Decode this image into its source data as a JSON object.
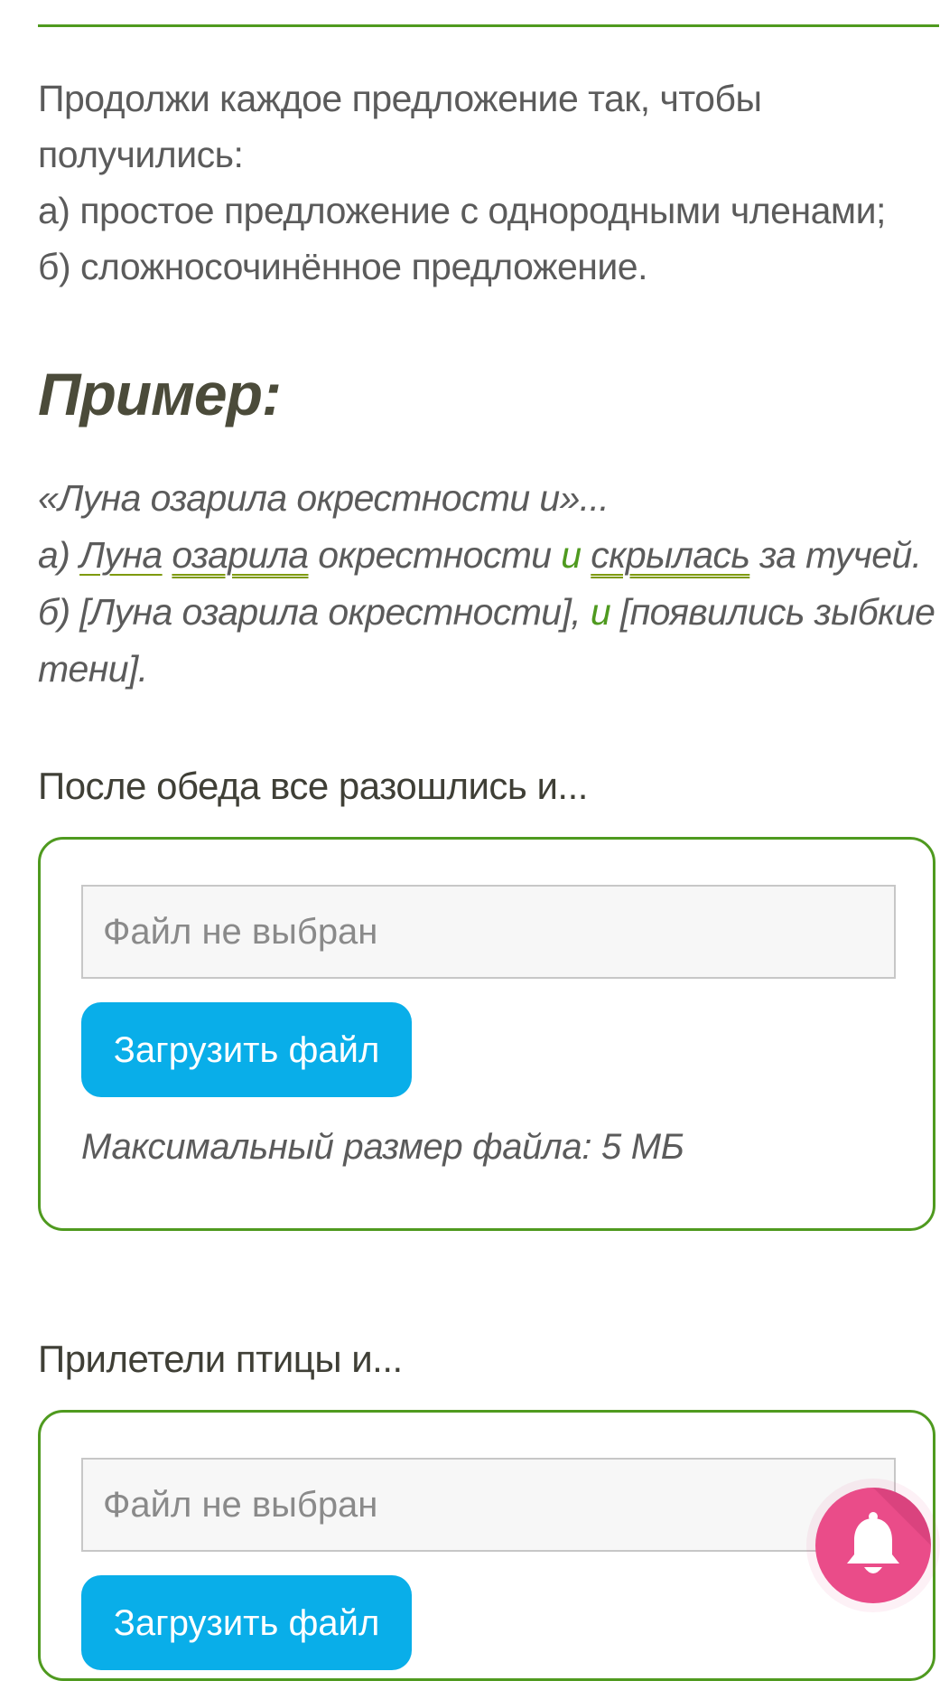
{
  "instructions": {
    "line1": "Продолжи каждое предложение так, чтобы",
    "line2": "получились:",
    "line3": "а) простое предложение с однородными членами;",
    "line4": "б) сложносочинённое предложение."
  },
  "example": {
    "heading": "Пример:",
    "quote": "«Луна озарила окрестности и»...",
    "a_prefix": "а) ",
    "a_subject": "Луна",
    "a_space1": " ",
    "a_predicate1": "озарила",
    "a_middle": " окрестности ",
    "a_conj": "и",
    "a_space2": " ",
    "a_predicate2": "скрылась",
    "a_end": " за тучей.",
    "b_prefix": "б) [Луна озарила окрестности], ",
    "b_conj": "и",
    "b_rest": " [появились зыбкие",
    "b_line2": "тени]."
  },
  "tasks": [
    {
      "prompt": "После обеда все разошлись и...",
      "file_status": "Файл не выбран",
      "upload_label": "Загрузить файл",
      "max_size": "Максимальный размер файла: 5 МБ"
    },
    {
      "prompt": "Прилетели птицы и...",
      "file_status": "Файл не выбран",
      "upload_label": "Загрузить файл"
    }
  ],
  "colors": {
    "accent_green": "#4f9a1f",
    "upload_blue": "#09aee9",
    "notification_pink": "#ea4c89"
  },
  "icons": {
    "notification": "bell-icon"
  }
}
